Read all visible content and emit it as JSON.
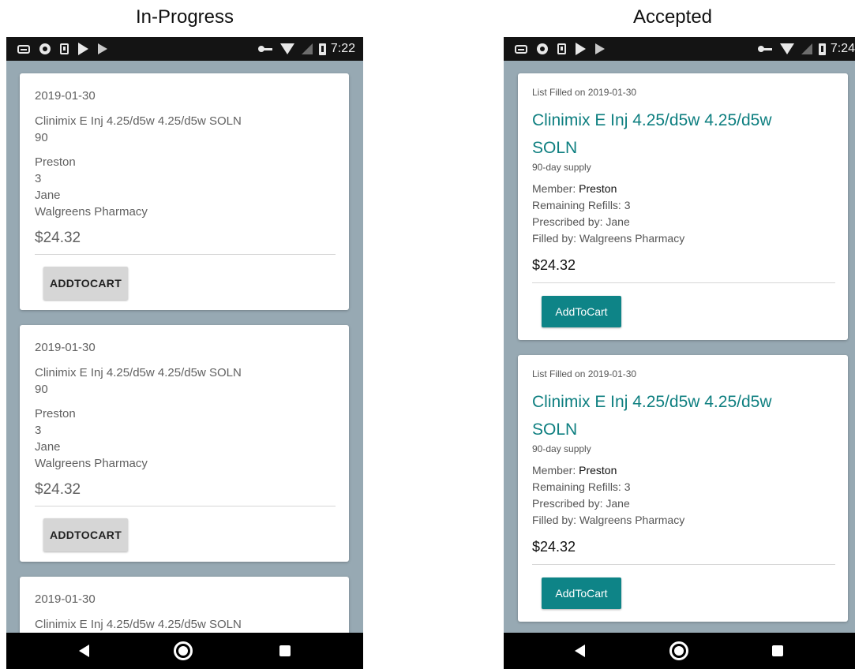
{
  "captions": {
    "left": "In-Progress",
    "right": "Accepted"
  },
  "status_left": {
    "time": "7:22"
  },
  "status_right": {
    "time": "7:24"
  },
  "colors": {
    "teal": "#0e8487",
    "page_bg": "#97a9b3",
    "statusbar": "#141414"
  },
  "in_progress_cards": [
    {
      "date": "2019-01-30",
      "drug": "Clinimix E Inj 4.25/d5w 4.25/d5w SOLN",
      "supply": "90",
      "member": "Preston",
      "refills": "3",
      "prescriber": "Jane",
      "pharmacy": "Walgreens Pharmacy",
      "price": "$24.32",
      "button": "ADDTOCART"
    },
    {
      "date": "2019-01-30",
      "drug": "Clinimix E Inj 4.25/d5w 4.25/d5w SOLN",
      "supply": "90",
      "member": "Preston",
      "refills": "3",
      "prescriber": "Jane",
      "pharmacy": "Walgreens Pharmacy",
      "price": "$24.32",
      "button": "ADDTOCART"
    },
    {
      "date": "2019-01-30",
      "drug": "Clinimix E Inj 4.25/d5w 4.25/d5w SOLN"
    }
  ],
  "accepted_cards": [
    {
      "filled": "List Filled on 2019-01-30",
      "drug": "Clinimix E Inj 4.25/d5w 4.25/d5w SOLN",
      "supply": "90-day supply",
      "member_label": "Member: ",
      "member": "Preston",
      "refills": "Remaining Refills: 3",
      "prescriber": "Prescribed by: Jane",
      "pharmacy": "Filled by: Walgreens Pharmacy",
      "price": "$24.32",
      "button": "AddToCart"
    },
    {
      "filled": "List Filled on 2019-01-30",
      "drug": "Clinimix E Inj 4.25/d5w 4.25/d5w SOLN",
      "supply": "90-day supply",
      "member_label": "Member: ",
      "member": "Preston",
      "refills": "Remaining Refills: 3",
      "prescriber": "Prescribed by: Jane",
      "pharmacy": "Filled by: Walgreens Pharmacy",
      "price": "$24.32",
      "button": "AddToCart"
    }
  ]
}
